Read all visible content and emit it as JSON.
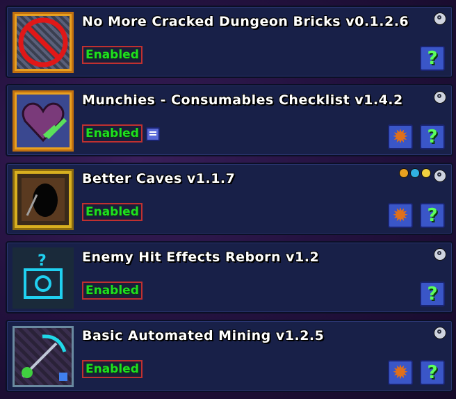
{
  "mods": [
    {
      "name": "No More Cracked Dungeon Bricks v0.1.2.6",
      "status": "Enabled",
      "icon": "no-cracked-bricks-icon",
      "has_config": false,
      "has_extra": false,
      "flags": []
    },
    {
      "name": "Munchies - Consumables Checklist v1.4.2",
      "status": "Enabled",
      "icon": "munchies-heart-icon",
      "has_config": true,
      "has_extra": true,
      "flags": []
    },
    {
      "name": "Better Caves v1.1.7",
      "status": "Enabled",
      "icon": "better-caves-icon",
      "has_config": true,
      "has_extra": false,
      "flags": [
        "client-side",
        "server-side",
        "time"
      ]
    },
    {
      "name": "Enemy Hit Effects Reborn v1.2",
      "status": "Enabled",
      "icon": "enemy-hit-effects-icon",
      "has_config": false,
      "has_extra": false,
      "flags": []
    },
    {
      "name": "Basic Automated Mining v1.2.5",
      "status": "Enabled",
      "icon": "automated-mining-icon",
      "has_config": true,
      "has_extra": false,
      "flags": []
    }
  ],
  "help_symbol": "?",
  "config_symbol": "✹",
  "colors": {
    "enabled_text": "#1fe01f",
    "panel": "#182048",
    "button": "#3a56c8"
  }
}
